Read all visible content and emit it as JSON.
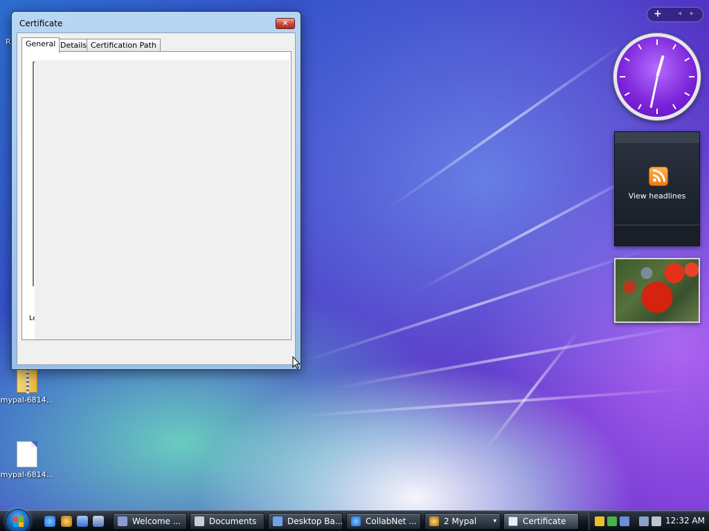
{
  "window": {
    "title": "Certificate",
    "close_glyph": "✕",
    "tabs": [
      {
        "label": "General",
        "active": true
      },
      {
        "label": "Details",
        "active": false
      },
      {
        "label": "Certification Path",
        "active": false
      }
    ],
    "truncated_text": "Le"
  },
  "desktop_icons": [
    {
      "label": "mypal-6814...",
      "icon": "zip-folder-icon"
    },
    {
      "label": "mypal-6814...",
      "icon": "file-icon"
    }
  ],
  "desktop_edge_text": "R",
  "sidebar": {
    "add_glyph": "+",
    "prev_glyph": "◂",
    "next_glyph": "▸",
    "clock": {
      "hour": 12,
      "minute": 32
    },
    "feed_label": "View headlines"
  },
  "taskbar": {
    "tasks": [
      {
        "label": "Welcome ...",
        "icon": "document-icon"
      },
      {
        "label": "Documents",
        "icon": "folder-icon"
      },
      {
        "label": "Desktop Ba...",
        "icon": "monitor-icon"
      },
      {
        "label": "CollabNet ...",
        "icon": "ie-icon"
      },
      {
        "label": "2 Mypal",
        "icon": "mypal-icon",
        "group_caret": "▾"
      },
      {
        "label": "Certificate",
        "icon": "certificate-icon",
        "active": true
      }
    ],
    "clock_time": "12:32 AM"
  },
  "colors": {
    "accent_purple": "#7a22d8",
    "taskbar": "#141a22",
    "close_red": "#c8463a"
  }
}
